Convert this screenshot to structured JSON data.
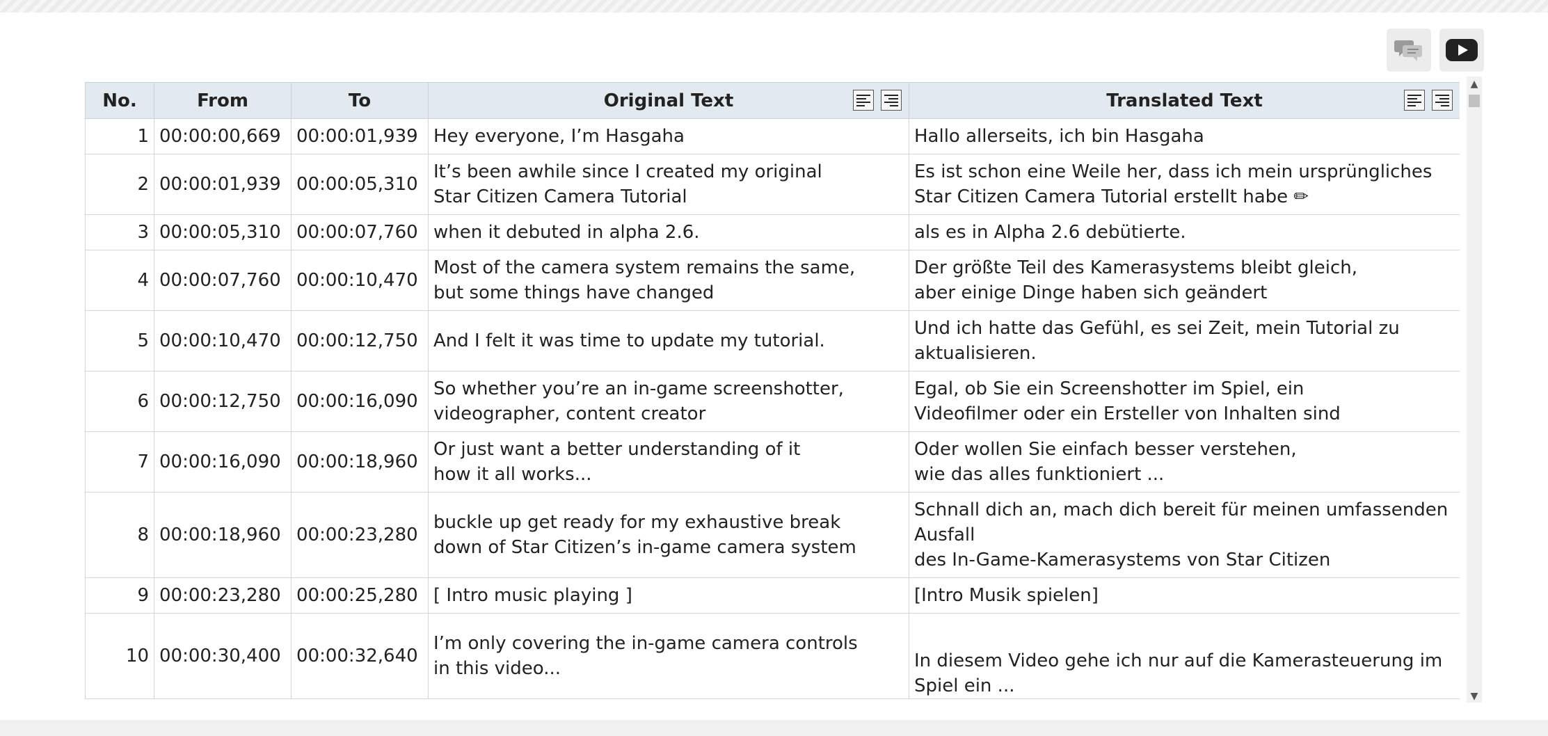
{
  "toolbar": {
    "subtitles_icon": "speech-bubbles-icon",
    "youtube_icon": "youtube-play-icon"
  },
  "table": {
    "headers": {
      "no": "No.",
      "from": "From",
      "to": "To",
      "original": "Original Text",
      "translated": "Translated Text"
    },
    "rows": [
      {
        "no": "1",
        "from": "00:00:00,669",
        "to": "00:00:01,939",
        "orig": [
          "Hey everyone, I’m Hasgaha"
        ],
        "trans": [
          "Hallo allerseits, ich bin Hasgaha"
        ]
      },
      {
        "no": "2",
        "from": "00:00:01,939",
        "to": "00:00:05,310",
        "orig": [
          "It’s been awhile since I created my original",
          "Star Citizen Camera Tutorial"
        ],
        "trans": [
          "Es ist schon eine Weile her, dass ich mein ursprüngliches",
          "Star Citizen Camera Tutorial erstellt habe ✏"
        ]
      },
      {
        "no": "3",
        "from": "00:00:05,310",
        "to": "00:00:07,760",
        "orig": [
          "when it debuted in alpha 2.6."
        ],
        "trans": [
          "als es in Alpha 2.6 debütierte."
        ]
      },
      {
        "no": "4",
        "from": "00:00:07,760",
        "to": "00:00:10,470",
        "orig": [
          "Most of the camera system remains the same,",
          "but some things have changed"
        ],
        "trans": [
          "Der größte Teil des Kamerasystems bleibt gleich,",
          "aber einige Dinge haben sich geändert"
        ]
      },
      {
        "no": "5",
        "from": "00:00:10,470",
        "to": "00:00:12,750",
        "orig": [
          "And I felt it was time to update my tutorial."
        ],
        "trans": [
          "Und ich hatte das Gefühl, es sei Zeit, mein Tutorial zu",
          "aktualisieren."
        ]
      },
      {
        "no": "6",
        "from": "00:00:12,750",
        "to": "00:00:16,090",
        "orig": [
          "So whether you’re an in-game screenshotter,",
          "videographer, content creator"
        ],
        "trans": [
          "Egal, ob Sie ein Screenshotter im Spiel, ein",
          "Videofilmer oder ein Ersteller von Inhalten sind"
        ]
      },
      {
        "no": "7",
        "from": "00:00:16,090",
        "to": "00:00:18,960",
        "orig": [
          "Or just want a better understanding of it",
          "how it all works..."
        ],
        "trans": [
          "Oder wollen Sie einfach besser verstehen,",
          "wie das alles funktioniert ..."
        ]
      },
      {
        "no": "8",
        "from": "00:00:18,960",
        "to": "00:00:23,280",
        "orig": [
          "buckle up get ready for my exhaustive break",
          "down of Star Citizen’s in-game camera system"
        ],
        "trans": [
          "Schnall dich an, mach dich bereit für meinen umfassenden",
          "Ausfall",
          "des In-Game-Kamerasystems von Star Citizen"
        ]
      },
      {
        "no": "9",
        "from": "00:00:23,280",
        "to": "00:00:25,280",
        "orig": [
          "[ Intro music playing ]"
        ],
        "trans": [
          "[Intro Musik spielen]"
        ]
      },
      {
        "no": "10",
        "from": "00:00:30,400",
        "to": "00:00:32,640",
        "orig": [
          "I’m only covering the in-game camera controls",
          "in this video..."
        ],
        "trans": [
          "In diesem Video gehe ich nur auf die Kamerasteuerung im",
          "Spiel ein ..."
        ]
      }
    ]
  }
}
